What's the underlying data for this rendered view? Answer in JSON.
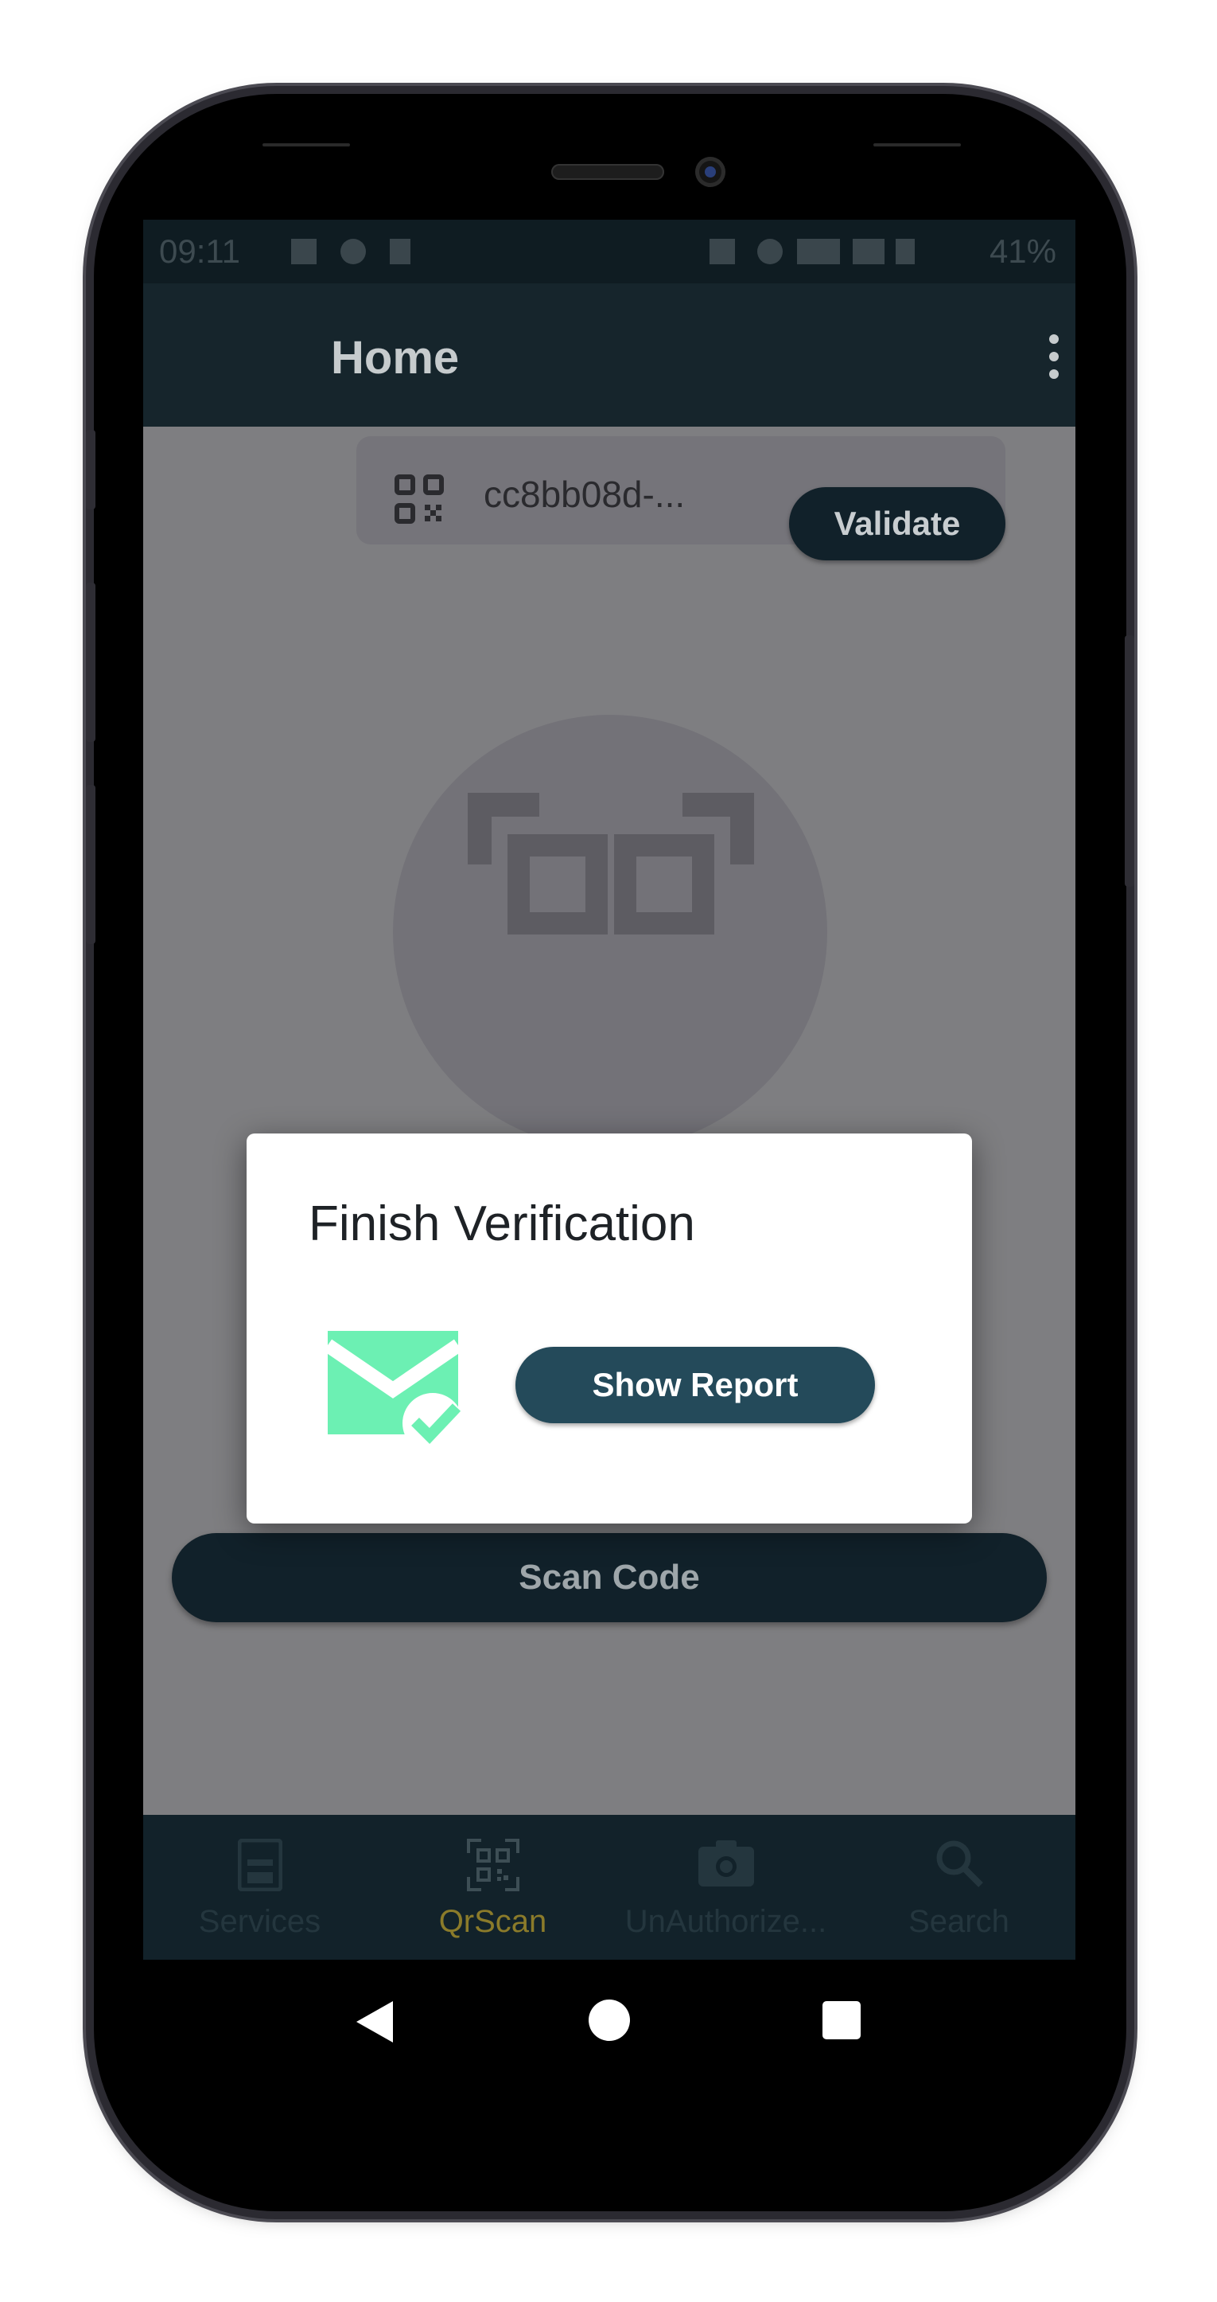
{
  "status_bar": {
    "time": "09:11",
    "battery": "41%"
  },
  "app_bar": {
    "title": "Home",
    "menu_icon": "more-vertical-icon"
  },
  "qr_chip": {
    "icon": "qr-code-icon",
    "code": "cc8bb08d-..."
  },
  "validate_button": "Validate",
  "scan_code_button": "Scan Code",
  "dialog": {
    "title": "Finish Verification",
    "illustration": "mail-check-icon",
    "show_report_button": "Show Report"
  },
  "bottom_nav": {
    "items": [
      {
        "label": "Services",
        "icon": "services-icon",
        "active": false
      },
      {
        "label": "QrScan",
        "icon": "qr-scan-icon",
        "active": true
      },
      {
        "label": "UnAuthorize...",
        "icon": "camera-icon",
        "active": false
      },
      {
        "label": "Search",
        "icon": "search-icon",
        "active": false
      }
    ]
  },
  "colors": {
    "app_bar": "#16252c",
    "overlay_content": "#7e7e81",
    "primary_button": "#244a5a",
    "accent_green": "#6cf0b3",
    "active_nav": "#8b7b2a"
  }
}
